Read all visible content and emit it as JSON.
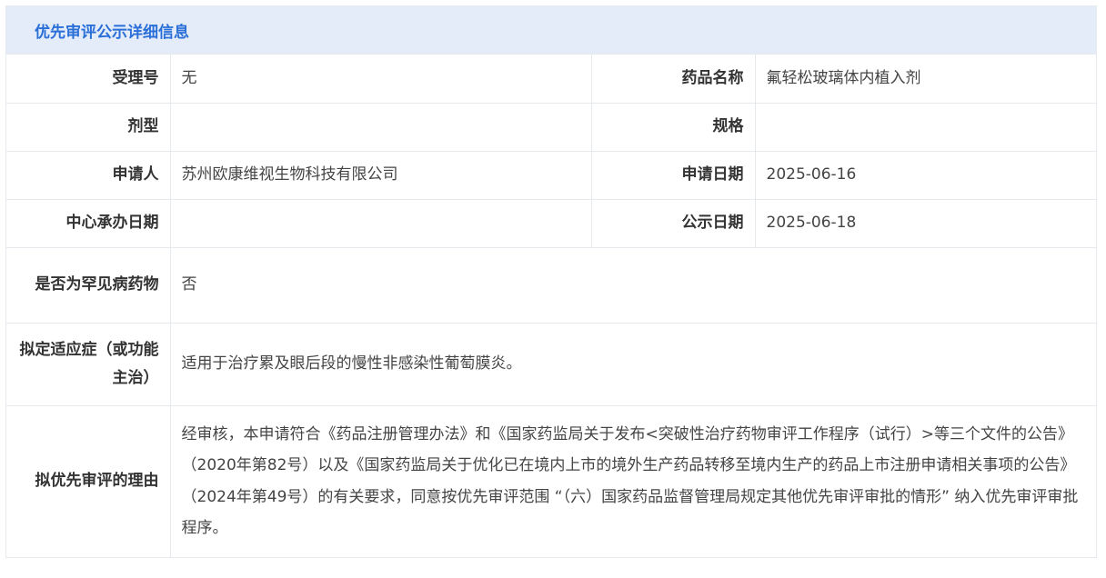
{
  "header": {
    "title": "优先审评公示详细信息"
  },
  "fields": {
    "accept_no": {
      "label": "受理号",
      "value": "无"
    },
    "drug_name": {
      "label": "药品名称",
      "value": "氟轻松玻璃体内植入剂"
    },
    "dosage_form": {
      "label": "剂型",
      "value": ""
    },
    "spec": {
      "label": "规格",
      "value": ""
    },
    "applicant": {
      "label": "申请人",
      "value": "苏州欧康维视生物科技有限公司"
    },
    "apply_date": {
      "label": "申请日期",
      "value": "2025-06-16"
    },
    "center_date": {
      "label": "中心承办日期",
      "value": ""
    },
    "publish_date": {
      "label": "公示日期",
      "value": "2025-06-18"
    },
    "rare_disease": {
      "label": "是否为罕见病药物",
      "value": "否"
    },
    "indication": {
      "label": "拟定适应症（或功能主治）",
      "value": "适用于治疗累及眼后段的慢性非感染性葡萄膜炎。"
    },
    "reason": {
      "label": "拟优先审评的理由",
      "value": "经审核，本申请符合《药品注册管理办法》和《国家药监局关于发布<突破性治疗药物审评工作程序（试行）>等三个文件的公告》（2020年第82号）以及《国家药监局关于优化已在境内上市的境外生产药品转移至境内生产的药品上市注册申请相关事项的公告》（2024年第49号）的有关要求，同意按优先审评范围 “（六）国家药品监督管理局规定其他优先审评审批的情形” 纳入优先审评审批程序。"
    }
  }
}
